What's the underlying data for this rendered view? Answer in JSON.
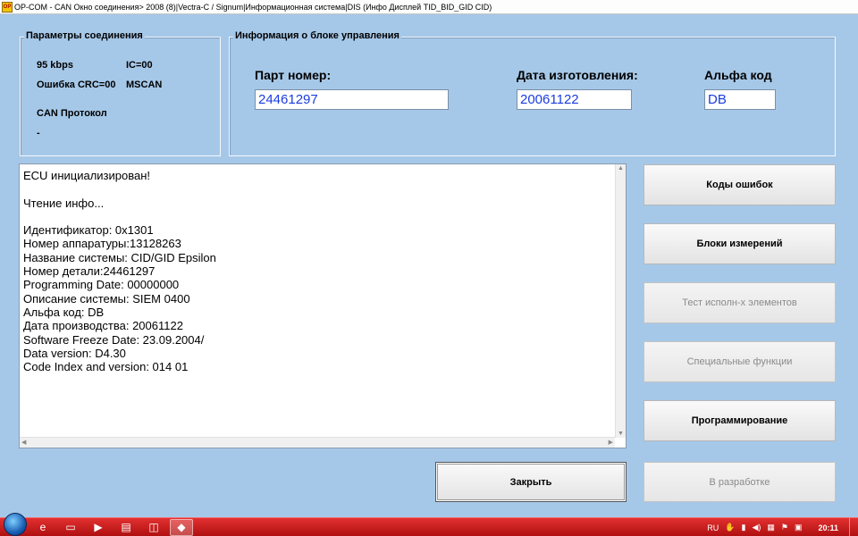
{
  "window": {
    "title": "OP-COM - CAN Окно соединения> 2008 (8)|Vectra-C / Signum|Информационная система|DIS (Инфо Дисплей TID_BID_GID CID)"
  },
  "connection": {
    "label": "Параметры соединения",
    "speed": "95 kbps",
    "ic": "IC=00",
    "crc_error": "Ошибка CRC=00",
    "bus": "MSCAN",
    "protocol_label": "CAN Протокол",
    "protocol_value": "-"
  },
  "ecu_info": {
    "label": "Информация о блоке управления",
    "part_label": "Парт номер:",
    "part_value": "24461297",
    "date_label": "Дата изготовления:",
    "date_value": "20061122",
    "alpha_label": "Альфа код",
    "alpha_value": "DB"
  },
  "log": {
    "lines": [
      "ECU инициализирован!",
      "",
      "Чтение инфо...",
      "",
      "Идентификатор: 0x1301",
      "Номер аппаратуры:13128263",
      "Название системы: CID/GID Epsilon",
      "Номер детали:24461297",
      "Programming Date: 00000000",
      "Описание системы: SIEM 0400",
      "Альфа код: DB",
      "Дата производства: 20061122",
      "Software Freeze Date: 23.09.2004/",
      "Data version: D4.30",
      "Code Index and version: 014 01"
    ]
  },
  "buttons": {
    "error_codes": "Коды ошибок",
    "measurement_blocks": "Блоки измерений",
    "actuator_test": "Тест исполн-х элементов",
    "special_functions": "Специальные функции",
    "programming": "Программирование",
    "in_development": "В разработке",
    "close": "Закрыть"
  },
  "taskbar": {
    "language": "RU",
    "clock": "20:11"
  }
}
